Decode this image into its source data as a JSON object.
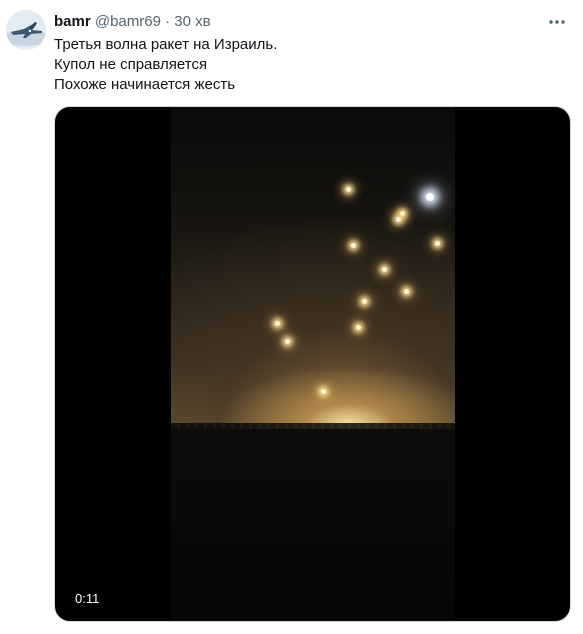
{
  "tweet": {
    "name": "bamr",
    "handle": "@bamr69",
    "separator": "·",
    "time": "30 хв",
    "lines": [
      "Третья волна ракет на Израиль.",
      "Купол не справляется",
      "Похоже начинается жесть"
    ],
    "more_icon": "more-horizontal-icon"
  },
  "video": {
    "duration": "0:11"
  },
  "colors": {
    "text_primary": "#0f1419",
    "text_secondary": "#536471",
    "media_background": "#000000"
  }
}
